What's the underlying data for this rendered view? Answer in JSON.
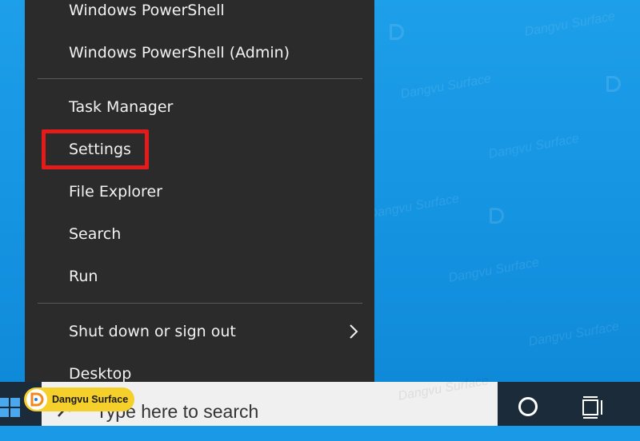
{
  "menu": {
    "items": [
      {
        "label": "Windows PowerShell"
      },
      {
        "label": "Windows PowerShell (Admin)"
      },
      {
        "label": "Task Manager"
      },
      {
        "label": "Settings"
      },
      {
        "label": "File Explorer"
      },
      {
        "label": "Search"
      },
      {
        "label": "Run"
      },
      {
        "label": "Shut down or sign out"
      },
      {
        "label": "Desktop"
      }
    ]
  },
  "taskbar": {
    "search_placeholder": "Type here to search"
  },
  "watermark": {
    "text": "Dangvu Surface"
  },
  "colors": {
    "desktop": "#1a9ae6",
    "menu_bg": "#2b2b2b",
    "highlight": "#e31b1b",
    "taskbar": "#1c2b3a",
    "badge": "#f5cf2a"
  }
}
